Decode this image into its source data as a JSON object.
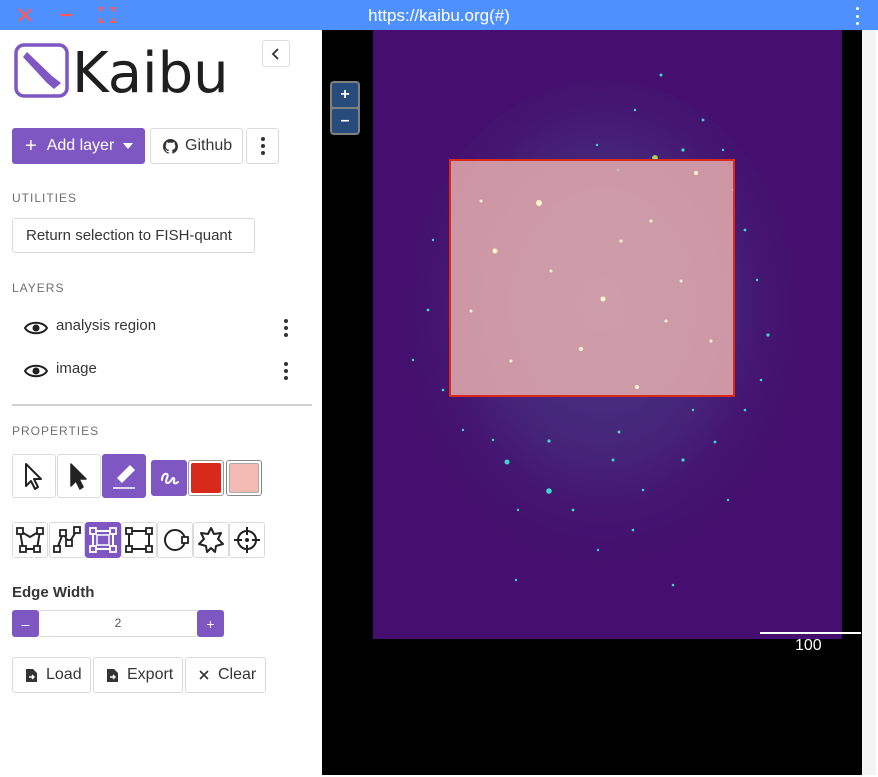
{
  "window": {
    "url": "https://kaibu.org(#)"
  },
  "app": {
    "name": "Kaibu"
  },
  "toolbar": {
    "add_layer_label": "Add layer",
    "github_label": "Github"
  },
  "utilities": {
    "section_label": "UTILITIES",
    "return_button_label": "Return selection to FISH-quant"
  },
  "layers": {
    "section_label": "LAYERS",
    "items": [
      {
        "name": "analysis region",
        "visible": true
      },
      {
        "name": "image",
        "visible": true
      }
    ]
  },
  "properties": {
    "section_label": "PROPERTIES",
    "edit_tools": [
      "pointer-outline",
      "pointer-filled",
      "draw",
      "freehand"
    ],
    "active_edit_tool": "draw",
    "edge_color": "#d9291b",
    "fill_color": "#f4bab4",
    "shape_tools": [
      "polygon",
      "polyline",
      "rectangle-select",
      "rectangle",
      "circle",
      "star",
      "point"
    ],
    "active_shape_tool": "rectangle-select",
    "edge_width_label": "Edge Width",
    "edge_width_value": "2",
    "decrement_label": "–",
    "increment_label": "+"
  },
  "actions": {
    "load_label": "Load",
    "export_label": "Export",
    "clear_label": "Clear"
  },
  "viewer": {
    "zoom_in_label": "+",
    "zoom_out_label": "–",
    "scale_bar_label": "100",
    "image_background": "#440f6e",
    "selection_edge_color": "#d9291b"
  },
  "colors": {
    "accent": "#7e57c2",
    "titlebar": "#4d90fe"
  }
}
